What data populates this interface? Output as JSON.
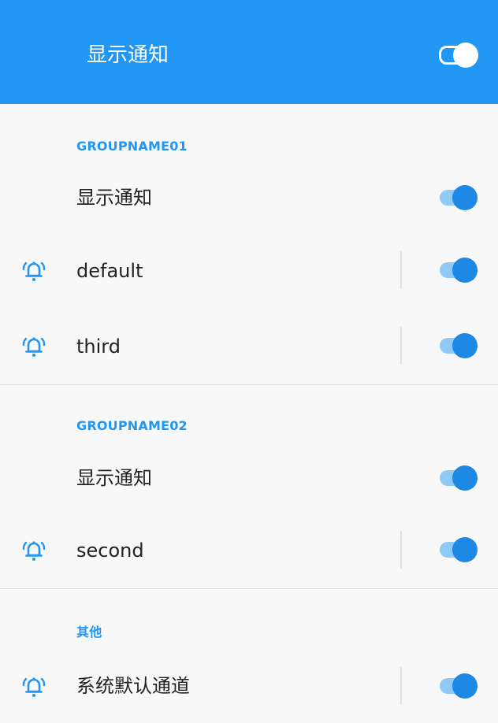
{
  "header": {
    "title": "显示通知",
    "toggle_on": true
  },
  "groups": [
    {
      "title": "GROUPNAME01",
      "master_label": "显示通知",
      "master_on": true,
      "channels": [
        {
          "label": "default",
          "icon": "bell-icon",
          "on": true
        },
        {
          "label": "third",
          "icon": "bell-icon",
          "on": true
        }
      ]
    },
    {
      "title": "GROUPNAME02",
      "master_label": "显示通知",
      "master_on": true,
      "channels": [
        {
          "label": "second",
          "icon": "bell-icon",
          "on": true
        }
      ]
    },
    {
      "title": "其他",
      "channels": [
        {
          "label": "系统默认通道",
          "icon": "bell-icon",
          "on": true
        }
      ]
    }
  ],
  "colors": {
    "accent": "#2196F3",
    "toggle_thumb": "#1e88e5",
    "toggle_track": "#8fcaf7",
    "background": "#f8f8f8"
  }
}
